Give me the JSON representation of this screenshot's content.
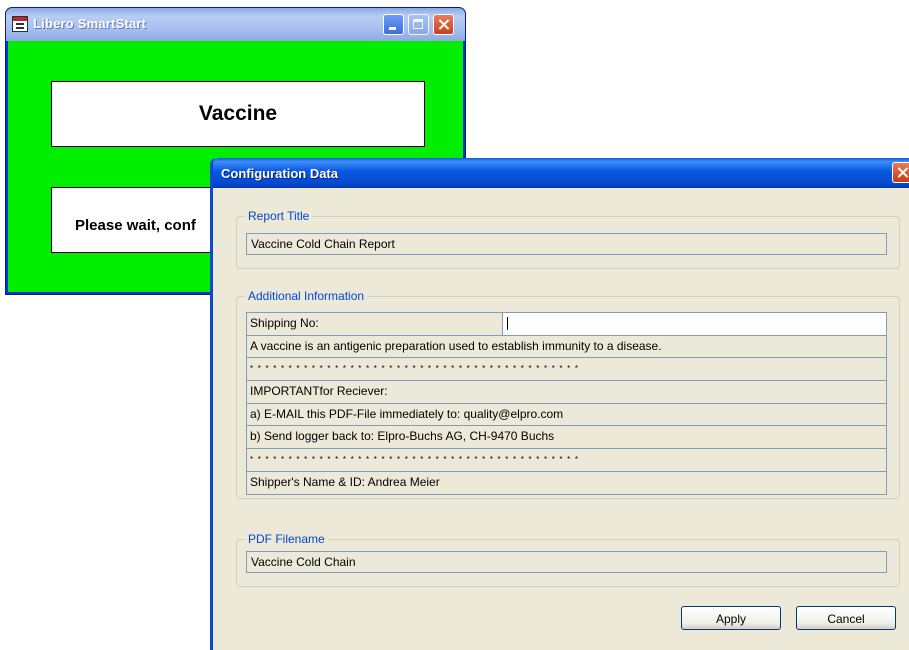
{
  "back_window": {
    "title": "Libero SmartStart",
    "product": "Vaccine",
    "status": "Please wait, conf"
  },
  "dialog": {
    "title": "Configuration Data",
    "report_title": {
      "legend": "Report Title",
      "value": "Vaccine Cold Chain Report"
    },
    "additional_info": {
      "legend": "Additional Information",
      "shipping_label": "Shipping No:",
      "shipping_value": "",
      "rows": [
        "A vaccine is an antigenic preparation used to establish immunity to a disease.",
        "* * * * * * * * * * * * * * * * * * * * * * * * * * * * * * * * * * * * * * * * * * *",
        "IMPORTANTfor Reciever:",
        "a) E-MAIL this PDF-File immediately to: quality@elpro.com",
        "b) Send logger back to: Elpro-Buchs AG, CH-9470 Buchs",
        "* * * * * * * * * * * * * * * * * * * * * * * * * * * * * * * * * * * * * * * * * * *",
        "Shipper's Name & ID: Andrea Meier"
      ]
    },
    "pdf_filename": {
      "legend": "PDF Filename",
      "value": "Vaccine Cold Chain"
    },
    "buttons": {
      "apply": "Apply",
      "cancel": "Cancel"
    }
  }
}
